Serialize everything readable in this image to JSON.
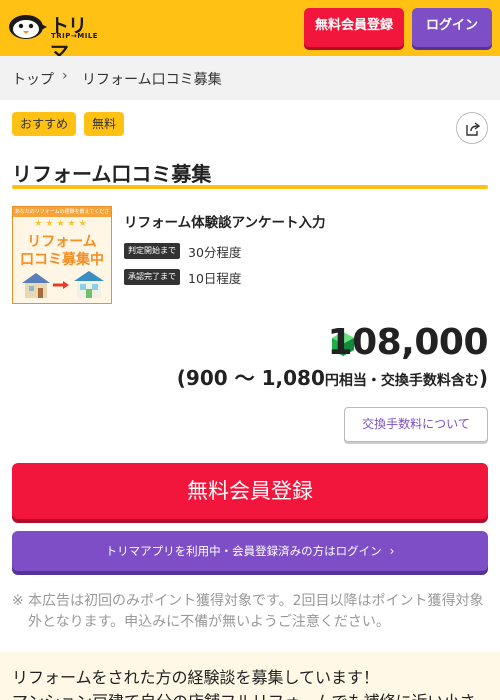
{
  "header": {
    "logo_text": "トリマ",
    "logo_sub": "TRIP→MILE",
    "register_label": "無料会員登録",
    "login_label": "ログイン"
  },
  "breadcrumb": {
    "home": "トップ",
    "separator": "›",
    "current": "リフォーム口コミ募集"
  },
  "tags": [
    "おすすめ",
    "無料"
  ],
  "page_title": "リフォーム口コミ募集",
  "offer": {
    "thumbnail": {
      "banner": "あなたのリフォームの経験を教えてください",
      "stars": "★★★★★",
      "line1": "リフォーム",
      "line2": "口コミ募集中"
    },
    "name": "リフォーム体験談アンケート入力",
    "conditions": [
      {
        "badge": "判定開始まで",
        "value": "30分程度"
      },
      {
        "badge": "承認完了まで",
        "value": "10日程度"
      }
    ]
  },
  "reward": {
    "points": "108,000",
    "yen_range": "(900 〜 1,080",
    "yen_suffix": "円相当・交換手数料含む",
    "yen_close": ")"
  },
  "buttons": {
    "fee_info": "交換手数料について",
    "register": "無料会員登録",
    "app_login": "トリマアプリを利用中・会員登録済みの方はログイン",
    "app_login_chevron": "›"
  },
  "notice": {
    "mark": "※",
    "text": "本広告は初回のみポイント獲得対象です。2回目以降はポイント獲得対象外となります。申込みに不備が無いようご注意ください。"
  },
  "description": {
    "line1": "リフォームをされた方の経験談を募集しています！",
    "line2": "マンション戸建て自分の店舗フルリフォームでも補修に近い小さ"
  },
  "colors": {
    "brand_yellow": "#fec114",
    "cta_red": "#f2163c",
    "login_purple": "#7d4ec6"
  }
}
